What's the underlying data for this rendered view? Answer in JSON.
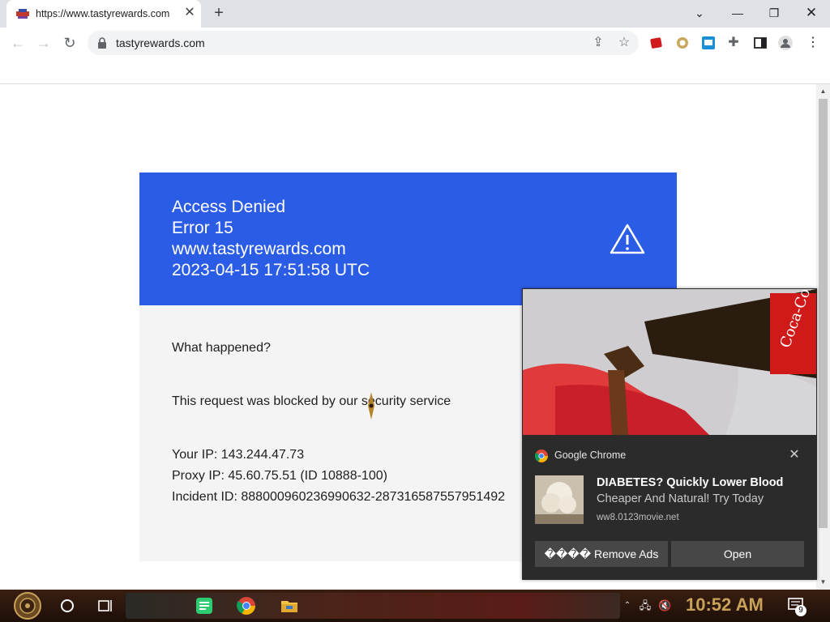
{
  "browser": {
    "tab_title": "https://www.tastyrewards.com",
    "tab_close": "✕",
    "new_tab": "+",
    "url": "tastyrewards.com"
  },
  "error_page": {
    "heading": "Access Denied",
    "error_code": "Error 15",
    "domain": "www.tastyrewards.com",
    "timestamp": "2023-04-15 17:51:58 UTC",
    "what_happened": "What happened?",
    "explanation": "This request was blocked by our security service",
    "your_ip": "Your IP: 143.244.47.73",
    "proxy_ip": "Proxy IP: 45.60.75.51 (ID 10888-100)",
    "incident_id": "Incident ID: 888000960236990632-287316587557951492",
    "accent_color": "#2b5ce6"
  },
  "notification": {
    "app_name": "Google Chrome",
    "title": "DIABETES? Quickly Lower Blood",
    "message": "Cheaper And Natural! Try Today",
    "source": "ww8.0123movie.net",
    "remove_ads_label": "���� Remove Ads",
    "open_label": "Open",
    "close_label": "✕"
  },
  "taskbar": {
    "time": "10:52 AM",
    "notification_count": "9"
  }
}
